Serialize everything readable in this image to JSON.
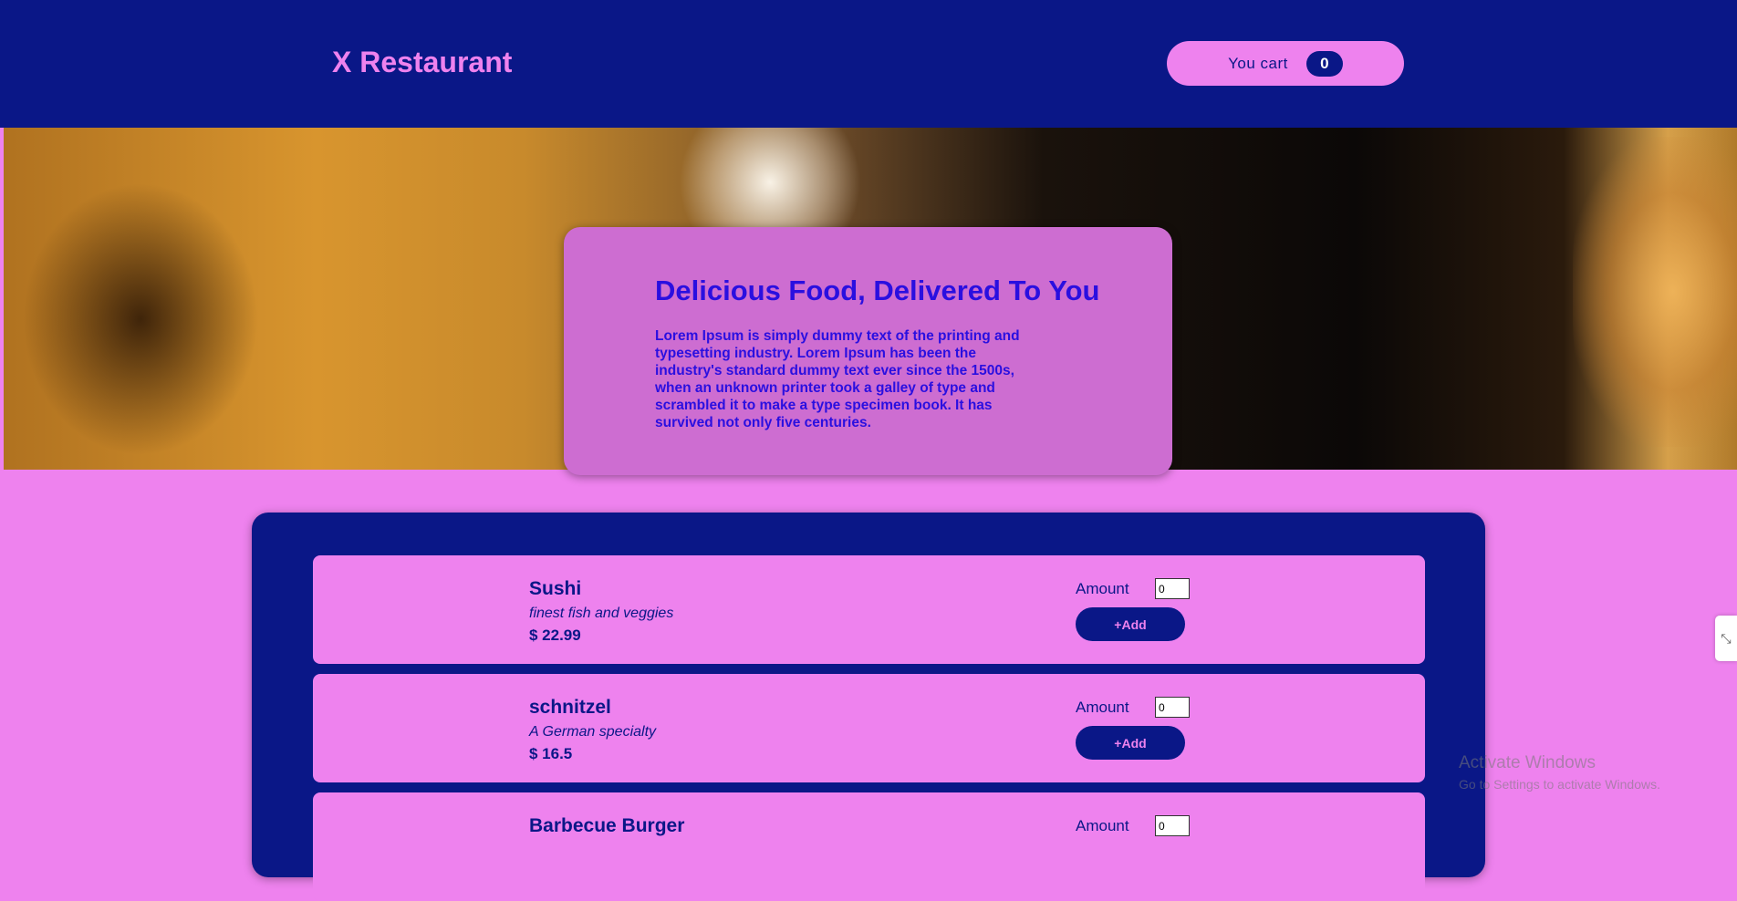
{
  "header": {
    "brand": "X Restaurant",
    "cart_label": "You cart",
    "cart_count": "0"
  },
  "hero": {
    "title": "Delicious Food, Delivered To You",
    "text": "Lorem Ipsum is simply dummy text of the printing and typesetting industry. Lorem Ipsum has been the industry's standard dummy text ever since the 1500s, when an unknown printer took a galley of type and scrambled it to make a type specimen book. It has survived not only five centuries."
  },
  "menu": {
    "items": [
      {
        "name": "Sushi",
        "description": "finest fish and veggies",
        "price": "$ 22.99",
        "amount_label": "Amount",
        "amount_value": "0",
        "add_label": "+Add"
      },
      {
        "name": "schnitzel",
        "description": "A German specialty",
        "price": "$ 16.5",
        "amount_label": "Amount",
        "amount_value": "0",
        "add_label": "+Add"
      },
      {
        "name": "Barbecue Burger",
        "description": "",
        "price": "",
        "amount_label": "Amount",
        "amount_value": "0",
        "add_label": ""
      }
    ]
  },
  "overlay": {
    "watermark_title": "Activate Windows",
    "watermark_subtitle": "Go to Settings to activate Windows.",
    "side_widget_icon": "collapse-icon"
  },
  "colors": {
    "primary": "#0a1787",
    "accent": "#ee82ee",
    "hero_card": "#cd6dd1",
    "hero_text": "#2a0fe0"
  }
}
